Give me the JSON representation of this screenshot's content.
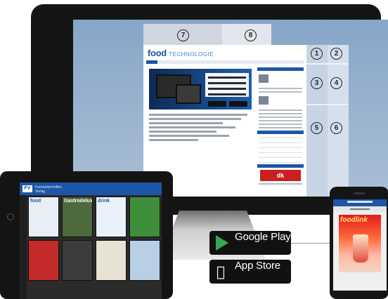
{
  "monitor": {
    "site": {
      "logo_main": "food",
      "logo_sub": "TECHNOLOGIE",
      "promo_badge": "dk"
    },
    "markers": [
      "1",
      "2",
      "3",
      "4",
      "5",
      "6",
      "7",
      "8"
    ]
  },
  "tablet": {
    "app_title_line1": "Fachzeitschriften",
    "app_title_line2": "Verlag",
    "magazines": [
      {
        "title": "food",
        "bg": "#e8eef5",
        "color": "#1d56a6"
      },
      {
        "title": "Gastrodeluxe",
        "bg": "#4d6a3c",
        "color": "#ffffff"
      },
      {
        "title": "drink",
        "bg": "#e9f2fa",
        "color": "#1d56a6"
      },
      {
        "title": "",
        "bg": "#3f8f3a",
        "color": "#ffffff"
      },
      {
        "title": "",
        "bg": "#c62b2b",
        "color": "#ffffff"
      },
      {
        "title": "",
        "bg": "#3c3c3c",
        "color": "#ffffff"
      },
      {
        "title": "",
        "bg": "#e7e2d3",
        "color": "#333333"
      },
      {
        "title": "",
        "bg": "#b8d0e6",
        "color": "#333333"
      }
    ]
  },
  "stores": {
    "google": "Google Play",
    "apple": "App Store"
  },
  "phone": {
    "cover_title": "foodlink"
  },
  "colors": {
    "brand_blue": "#1d56a6",
    "screen_bg": "#9bb4cf"
  }
}
